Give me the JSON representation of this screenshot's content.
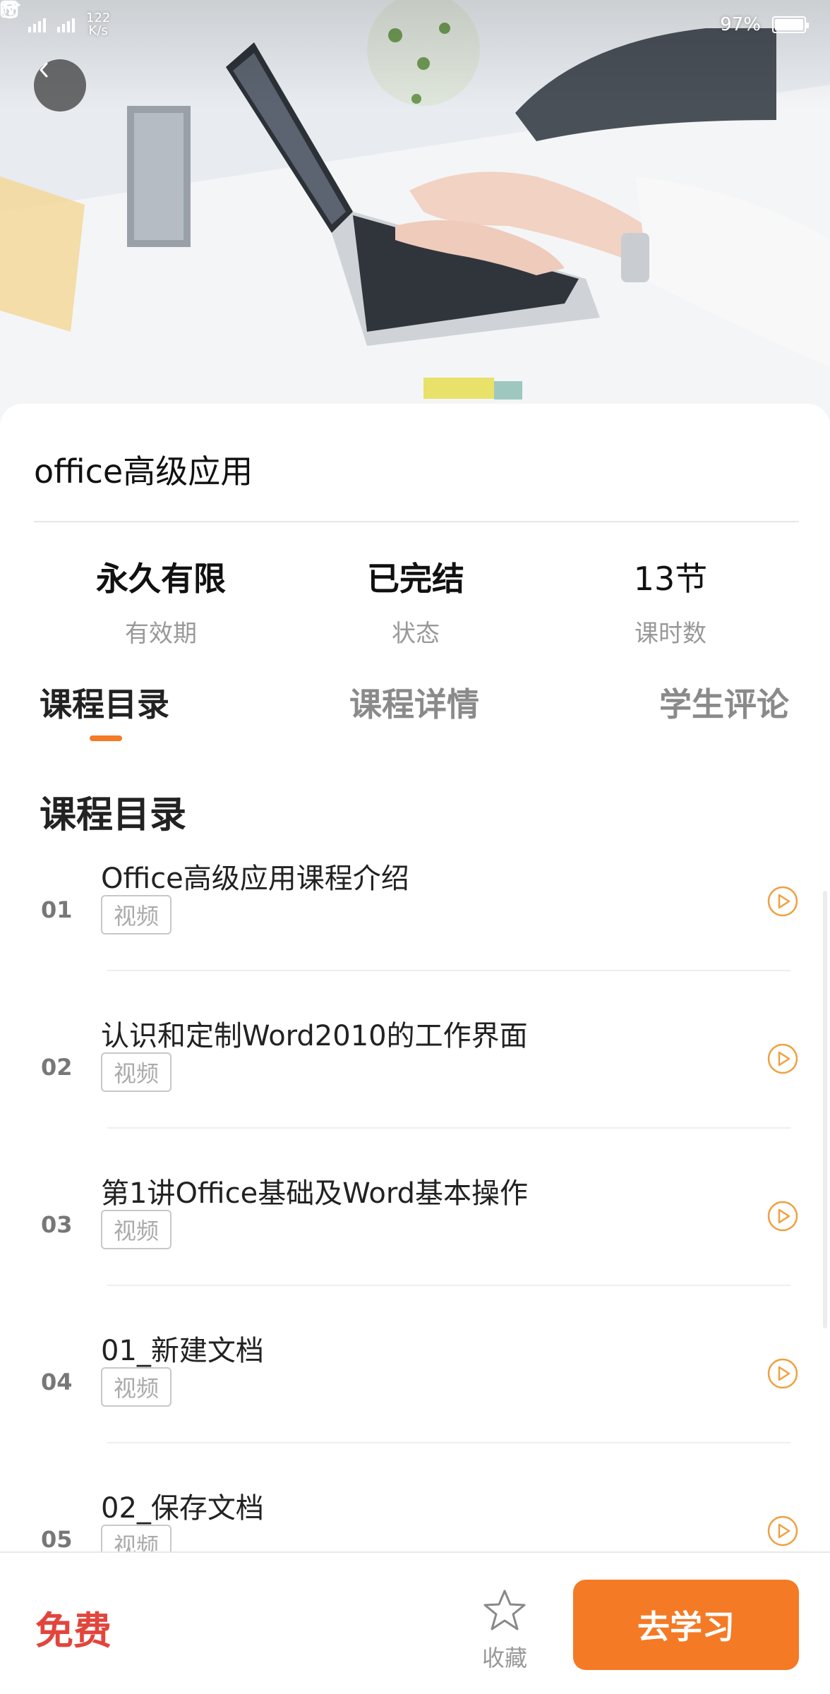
{
  "status_bar": {
    "net_speed": "122",
    "net_unit": "K/s",
    "battery": "97%"
  },
  "course": {
    "title": "office高级应用"
  },
  "stats": [
    {
      "value": "永久有限",
      "label": "有效期"
    },
    {
      "value": "已完结",
      "label": "状态"
    },
    {
      "value": "13节",
      "label": "课时数"
    }
  ],
  "tabs": [
    {
      "label": "课程目录",
      "active": true
    },
    {
      "label": "课程详情",
      "active": false
    },
    {
      "label": "学生评论",
      "active": false
    }
  ],
  "section_heading": "课程目录",
  "lessons": [
    {
      "num": "01",
      "title": "Office高级应用课程介绍",
      "tag": "视频"
    },
    {
      "num": "02",
      "title": "认识和定制Word2010的工作界面",
      "tag": "视频"
    },
    {
      "num": "03",
      "title": "第1讲Office基础及Word基本操作",
      "tag": "视频"
    },
    {
      "num": "04",
      "title": "01_新建文档",
      "tag": "视频"
    },
    {
      "num": "05",
      "title": "02_保存文档",
      "tag": "视频"
    }
  ],
  "bottom_bar": {
    "price": "免费",
    "favorite_label": "收藏",
    "study_button": "去学习"
  },
  "colors": {
    "accent": "#f47a25",
    "price": "#e2453c"
  },
  "icons": {
    "back": "chevron-left-icon",
    "play": "play-circle-icon",
    "favorite": "star-outline-icon"
  }
}
